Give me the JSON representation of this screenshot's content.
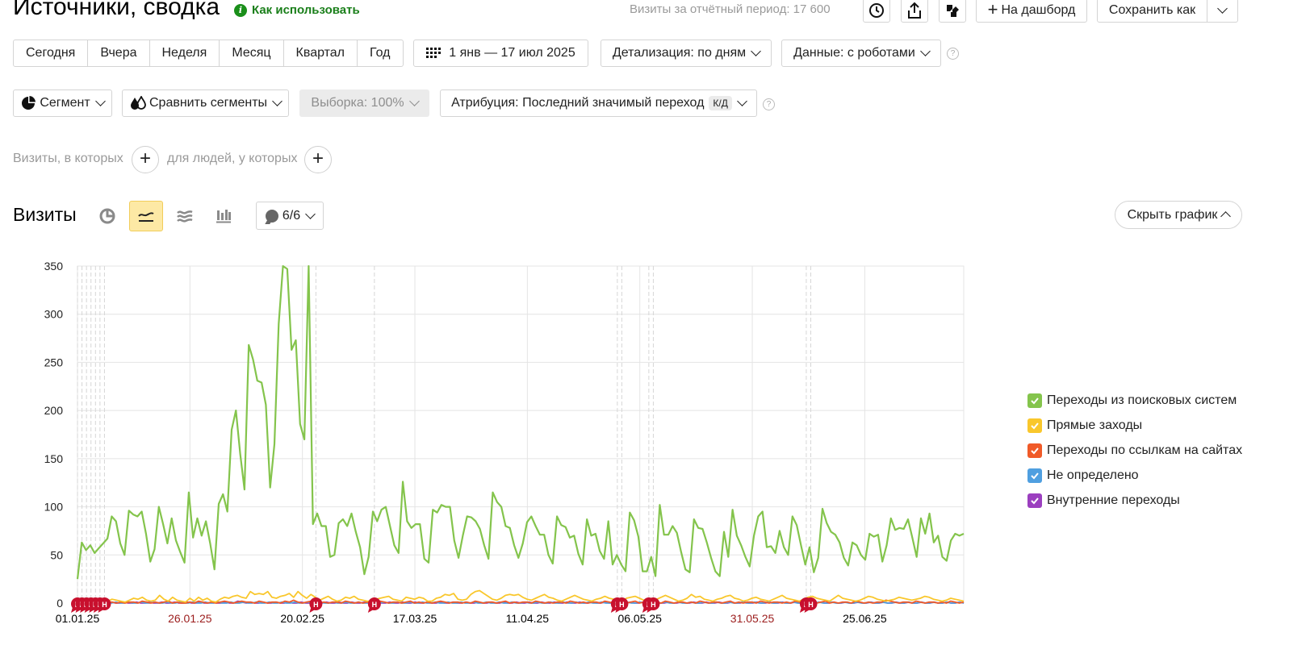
{
  "header": {
    "title": "Источники, сводка",
    "how_to_use": "Как использовать",
    "visits_period_label": "Визиты за отчётный период: 17 600",
    "to_dashboard": "На дашборд",
    "save_as": "Сохранить как"
  },
  "period": {
    "buttons": [
      "Сегодня",
      "Вчера",
      "Неделя",
      "Месяц",
      "Квартал",
      "Год"
    ],
    "date_range": "1 янв — 17 июл 2025",
    "detail": "Детализация: по дням",
    "data": "Данные: с роботами"
  },
  "segments": {
    "segment": "Сегмент",
    "compare": "Сравнить сегменты",
    "sample": "Выборка: 100%",
    "attribution": "Атрибуция: Последний значимый переход",
    "attribution_badge": "К/Д"
  },
  "filters": {
    "visits_where": "Визиты, в которых",
    "people_where": "для людей, у которых"
  },
  "chart_section": {
    "title": "Визиты",
    "annotations_count": "6/6",
    "hide_chart": "Скрыть график"
  },
  "chart_data": {
    "type": "line",
    "title": "",
    "xlabel": "",
    "ylabel": "",
    "ylim": [
      0,
      350
    ],
    "yticks": [
      0,
      50,
      100,
      150,
      200,
      250,
      300,
      350
    ],
    "x_start": "2025-01-01",
    "x_end": "2025-07-17",
    "x_tick_labels": [
      {
        "label": "01.01.25",
        "date": "2025-01-01",
        "color": "#000000"
      },
      {
        "label": "26.01.25",
        "date": "2025-01-26",
        "color": "#9b1c1c"
      },
      {
        "label": "20.02.25",
        "date": "2025-02-20",
        "color": "#000000"
      },
      {
        "label": "17.03.25",
        "date": "2025-03-17",
        "color": "#000000"
      },
      {
        "label": "11.04.25",
        "date": "2025-04-11",
        "color": "#000000"
      },
      {
        "label": "06.05.25",
        "date": "2025-05-06",
        "color": "#000000"
      },
      {
        "label": "31.05.25",
        "date": "2025-05-31",
        "color": "#9b1c1c"
      },
      {
        "label": "25.06.25",
        "date": "2025-06-25",
        "color": "#000000"
      }
    ],
    "weekly_grid_dates": [
      "2025-01-26",
      "2025-02-20",
      "2025-03-17",
      "2025-04-11",
      "2025-05-06",
      "2025-05-31",
      "2025-06-25"
    ],
    "annotation_dates": [
      "2025-01-01",
      "2025-01-02",
      "2025-01-03",
      "2025-01-04",
      "2025-01-05",
      "2025-01-06",
      "2025-01-07",
      "2025-02-23",
      "2025-03-08",
      "2025-05-01",
      "2025-05-02",
      "2025-05-08",
      "2025-05-09",
      "2025-06-12",
      "2025-06-13"
    ],
    "annotation_label": "Н",
    "grid": true,
    "legend_position": "right",
    "series": [
      {
        "name": "Переходы из поисковых систем",
        "color": "#84c44c",
        "values": [
          25,
          63,
          55,
          60,
          52,
          57,
          62,
          67,
          90,
          85,
          62,
          50,
          96,
          92,
          90,
          95,
          72,
          43,
          56,
          100,
          82,
          62,
          88,
          65,
          53,
          42,
          115,
          68,
          88,
          70,
          85,
          62,
          35,
          103,
          113,
          95,
          180,
          200,
          155,
          118,
          268,
          253,
          231,
          229,
          206,
          120,
          165,
          290,
          350,
          347,
          263,
          273,
          186,
          170,
          350,
          82,
          93,
          80,
          80,
          48,
          50,
          83,
          87,
          80,
          93,
          74,
          58,
          30,
          48,
          95,
          85,
          97,
          100,
          80,
          60,
          52,
          126,
          85,
          78,
          82,
          82,
          46,
          42,
          97,
          94,
          102,
          100,
          100,
          65,
          47,
          70,
          90,
          89,
          85,
          77,
          60,
          46,
          115,
          105,
          100,
          80,
          78,
          60,
          47,
          62,
          84,
          90,
          80,
          71,
          71,
          50,
          41,
          90,
          81,
          79,
          68,
          70,
          51,
          40,
          87,
          70,
          72,
          54,
          46,
          85,
          40,
          50,
          40,
          33,
          94,
          86,
          69,
          33,
          33,
          48,
          28,
          102,
          71,
          71,
          80,
          73,
          53,
          35,
          32,
          87,
          78,
          77,
          63,
          47,
          33,
          28,
          74,
          48,
          97,
          70,
          60,
          48,
          38,
          70,
          90,
          95,
          58,
          59,
          52,
          75,
          58,
          50,
          90,
          81,
          60,
          40,
          58,
          32,
          47,
          98,
          83,
          74,
          71,
          63,
          47,
          39,
          63,
          60,
          50,
          45,
          72,
          69,
          71,
          43,
          60,
          88,
          76,
          78,
          77,
          87,
          68,
          48,
          88,
          72,
          93,
          63,
          70,
          48,
          44,
          65,
          72,
          70,
          72
        ]
      },
      {
        "name": "Прямые заходы",
        "color": "#f9c72c",
        "values": [
          2,
          1,
          3,
          2,
          2,
          1,
          3,
          2,
          4,
          3,
          2,
          1,
          3,
          5,
          4,
          6,
          3,
          2,
          3,
          8,
          4,
          2,
          6,
          3,
          2,
          1,
          5,
          2,
          6,
          3,
          5,
          2,
          1,
          4,
          6,
          5,
          7,
          8,
          6,
          5,
          12,
          9,
          10,
          9,
          12,
          6,
          5,
          7,
          8,
          10,
          6,
          12,
          8,
          5,
          9,
          6,
          3,
          5,
          7,
          4,
          2,
          3,
          6,
          5,
          7,
          4,
          3,
          2,
          2,
          4,
          5,
          6,
          7,
          4,
          3,
          2,
          6,
          5,
          4,
          6,
          5,
          2,
          2,
          5,
          6,
          9,
          8,
          10,
          4,
          3,
          4,
          9,
          12,
          13,
          10,
          7,
          4,
          3,
          5,
          8,
          9,
          8,
          9,
          6,
          4,
          3,
          5,
          7,
          9,
          6,
          5,
          3,
          2,
          4,
          6,
          8,
          6,
          4,
          3,
          2,
          4,
          5,
          7,
          5,
          4,
          2,
          2,
          5,
          6,
          7,
          5,
          3,
          2,
          3,
          4,
          6,
          8,
          6,
          4,
          2,
          3,
          5,
          9,
          6,
          7,
          4,
          3,
          2,
          4,
          5,
          7,
          8,
          5,
          4,
          2,
          3,
          5,
          6,
          4,
          3,
          2,
          4,
          6,
          8,
          5,
          4,
          3,
          2,
          4,
          6,
          7,
          5,
          4,
          3,
          2,
          5,
          8,
          5,
          4,
          3,
          2,
          3,
          5,
          7,
          6,
          4,
          3,
          2,
          3,
          4,
          6,
          5,
          4,
          3,
          4,
          5,
          7,
          6,
          4,
          3,
          2,
          3,
          5,
          4,
          3,
          2
        ]
      },
      {
        "name": "Переходы по ссылкам на сайтах",
        "color": "#f05a28",
        "values": [
          0,
          0,
          1,
          0,
          1,
          0,
          2,
          1,
          1,
          0,
          1,
          0,
          1,
          1,
          0,
          2,
          1,
          0,
          1,
          0,
          1,
          2,
          0,
          1,
          0,
          0,
          1,
          0,
          2,
          1,
          0,
          1,
          0,
          1,
          2,
          1,
          0,
          1,
          2,
          1,
          1,
          0,
          2,
          1,
          0,
          1,
          1,
          0,
          2,
          1,
          3,
          1,
          0,
          1,
          2,
          1,
          0,
          1,
          0,
          1,
          1,
          0,
          2,
          1,
          0,
          1,
          0,
          1,
          1,
          0,
          2,
          1,
          0,
          1,
          1,
          0,
          1,
          2,
          0,
          1,
          0,
          1,
          0,
          1,
          2,
          1,
          0,
          1,
          1,
          0,
          1,
          0,
          2,
          1,
          0,
          1,
          1,
          0,
          1,
          2,
          0,
          1,
          0,
          1,
          1,
          0,
          2,
          1,
          0,
          1,
          0,
          1,
          1,
          0,
          2,
          1,
          0,
          1,
          0,
          1,
          1,
          0,
          2,
          1,
          0,
          1,
          1,
          0,
          1,
          2,
          0,
          1,
          0,
          1,
          1,
          0,
          2,
          1,
          0,
          1,
          1,
          0,
          1,
          0,
          2,
          1,
          0,
          1,
          1,
          0,
          1,
          2,
          0,
          1,
          0,
          1,
          1,
          0,
          2,
          1,
          0,
          1,
          1,
          0,
          1,
          0,
          2,
          1,
          0,
          1,
          1,
          0,
          1,
          2,
          0,
          1,
          0,
          1,
          1,
          0,
          2,
          1,
          0,
          1,
          0,
          1,
          1,
          3,
          2,
          1,
          0,
          1,
          1,
          0,
          2,
          1,
          0,
          1,
          1,
          0,
          1,
          0,
          2,
          1,
          0,
          1
        ]
      },
      {
        "name": "Не определено",
        "color": "#4f9fe0",
        "values": [
          1,
          0,
          0,
          1,
          0,
          0,
          1,
          0,
          0,
          1,
          0,
          0,
          1,
          0,
          0,
          1,
          0,
          0,
          1,
          0,
          0,
          1,
          0,
          0,
          1,
          0,
          0,
          1,
          0,
          0,
          1,
          0,
          0,
          1,
          0,
          0,
          1,
          0,
          0,
          1,
          0,
          0,
          1,
          0,
          0,
          1,
          0,
          0,
          1,
          0,
          0,
          1,
          0,
          0,
          1,
          0,
          0,
          1,
          0,
          0,
          1,
          0,
          0,
          1,
          0,
          0,
          1,
          0,
          0,
          1,
          0,
          0,
          1,
          0,
          0,
          1,
          0,
          0,
          1,
          0,
          0,
          1,
          0,
          0,
          1,
          0,
          0,
          1,
          0,
          0,
          1,
          0,
          0,
          1,
          0,
          0,
          1,
          0,
          0,
          1,
          0,
          0,
          1,
          0,
          0,
          1,
          0,
          0,
          1,
          0,
          0,
          1,
          0,
          0,
          1,
          0,
          0,
          1,
          0,
          0,
          1,
          0,
          0,
          1,
          0,
          0,
          1,
          0,
          0,
          1,
          0,
          0,
          1,
          0,
          0,
          1,
          0,
          0,
          1,
          0,
          0,
          1,
          0,
          0,
          1,
          0,
          0,
          1,
          0,
          0,
          1,
          0,
          0,
          1,
          0,
          0,
          1,
          0,
          0,
          1,
          0,
          0,
          1,
          0,
          0,
          1,
          0,
          0,
          1,
          0,
          0,
          1,
          0,
          0,
          1,
          0,
          0,
          1,
          0,
          0,
          1,
          0,
          0,
          1,
          0,
          0,
          1,
          0,
          0,
          1,
          0,
          0,
          1,
          0,
          0,
          1,
          0,
          0,
          1,
          0,
          0,
          1,
          0,
          0,
          1,
          0,
          0,
          1,
          0
        ]
      },
      {
        "name": "Внутренние переходы",
        "color": "#9b3fbf",
        "values": [
          1,
          0,
          1,
          0,
          0,
          1,
          0,
          0,
          1,
          0,
          0,
          1,
          0,
          0,
          1,
          0,
          0,
          1,
          0,
          0,
          1,
          0,
          0,
          1,
          0,
          0,
          1,
          0,
          0,
          1,
          0,
          0,
          1,
          0,
          0,
          1,
          0,
          0,
          2,
          1,
          0,
          1,
          0,
          0,
          1,
          0,
          0,
          1,
          0,
          0,
          1,
          0,
          0,
          1,
          0,
          0,
          1,
          0,
          0,
          1,
          0,
          0,
          1,
          0,
          0,
          1,
          0,
          0,
          1,
          0,
          0,
          1,
          0,
          0,
          1,
          0,
          0,
          1,
          0,
          0,
          1,
          0,
          0,
          1,
          0,
          0,
          1,
          0,
          0,
          1,
          0,
          0,
          1,
          0,
          0,
          1,
          0,
          0,
          1,
          0,
          0,
          1,
          0,
          0,
          1,
          0,
          0,
          1,
          0,
          0,
          1,
          0,
          0,
          1,
          0,
          0,
          1,
          0,
          0,
          1,
          0,
          0,
          1,
          0,
          0,
          1,
          0,
          0,
          1,
          0,
          0,
          1,
          0,
          0,
          1,
          0,
          0,
          1,
          0,
          0,
          1,
          0,
          0,
          1,
          0,
          0,
          1,
          0,
          0,
          1,
          0,
          0,
          1,
          0,
          0,
          1,
          0,
          0,
          1,
          0,
          0,
          1,
          0,
          0,
          1,
          0,
          0,
          1,
          0,
          0,
          1,
          0,
          0,
          1,
          0,
          0,
          1,
          0,
          0,
          1,
          0,
          0,
          1,
          0,
          0,
          1,
          0,
          0,
          1,
          0,
          0,
          1,
          0,
          0,
          1,
          0,
          0,
          1,
          0,
          0,
          1,
          0,
          0,
          1,
          0,
          0,
          1,
          0,
          0,
          1,
          0
        ]
      }
    ]
  }
}
